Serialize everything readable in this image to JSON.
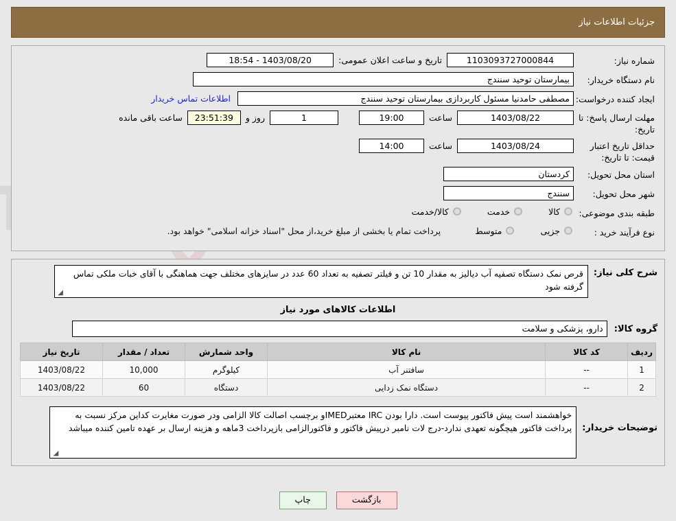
{
  "header": {
    "title": "جزئیات اطلاعات نیاز"
  },
  "fields": {
    "need_number_label": "شماره نیاز:",
    "need_number_value": "1103093727000844",
    "announce_label": "تاریخ و ساعت اعلان عمومی:",
    "announce_value": "1403/08/20 - 18:54",
    "buyer_org_label": "نام دستگاه خریدار:",
    "buyer_org_value": "بیمارستان توحید سنندج",
    "requester_label": "ایجاد کننده درخواست:",
    "requester_value": "مصطفی حامدنیا مسئول کاربردازی بیمارستان توحید سنندج",
    "contact_link": "اطلاعات تماس خریدار",
    "reply_deadline_label": "مهلت ارسال پاسخ: تا تاریخ:",
    "reply_deadline_date": "1403/08/22",
    "hour_label": "ساعت",
    "reply_deadline_time": "19:00",
    "days_value": "1",
    "days_sep_label": "روز و",
    "countdown_value": "23:51:39",
    "countdown_suffix": "ساعت باقی مانده",
    "price_validity_label": "حداقل تاریخ اعتبار قیمت: تا تاریخ:",
    "price_validity_date": "1403/08/24",
    "price_validity_time": "14:00",
    "province_label": "استان محل تحویل:",
    "province_value": "کردستان",
    "city_label": "شهر محل تحویل:",
    "city_value": "سنندج",
    "category_label": "طبقه بندی موضوعی:",
    "category_options": [
      "کالا",
      "خدمت",
      "کالا/خدمت"
    ],
    "process_label": "نوع فرآیند خرید :",
    "process_options": [
      "جزیی",
      "متوسط"
    ],
    "process_note": "پرداخت تمام یا بخشی از مبلغ خرید،از محل \"اسناد خزانه اسلامی\" خواهد بود."
  },
  "description": {
    "label": "شرح کلی نیاز:",
    "value": "قرص نمک دستگاه تصفیه آب دیالیز به مقدار 10 تن و فیلتر تصفیه به تعداد 60 عدد در سایزهای مختلف جهت هماهنگی با آقای خبات ملکی تماس گرفته شود"
  },
  "goods_section": {
    "title": "اطلاعات کالاهای مورد نیاز",
    "group_label": "گروه کالا:",
    "group_value": "دارو، پزشکی و سلامت",
    "columns": [
      "ردیف",
      "کد کالا",
      "نام کالا",
      "واحد شمارش",
      "تعداد / مقدار",
      "تاریخ نیاز"
    ],
    "rows": [
      {
        "row": "1",
        "code": "--",
        "name": "سافتنر آب",
        "unit": "کیلوگرم",
        "qty": "10,000",
        "date": "1403/08/22"
      },
      {
        "row": "2",
        "code": "--",
        "name": "دستگاه نمک زدایی",
        "unit": "دستگاه",
        "qty": "60",
        "date": "1403/08/22"
      }
    ]
  },
  "buyer_notes": {
    "label": "توضیحات خریدار:",
    "value": "خواهشمند است پیش فاکتور پیوست است. دارا بودن IRC معتبرIMEDو برچسب اصالت کالا الزامی ودر صورت مغایرت کداین مرکز نسبت به پرداخت فاکتور هیچگونه تعهدی ندارد-درج لات نامبر درپیش فاکتور و فاکتورالزامی  بازپرداخت 3ماهه و هزینه ارسال بر عهده تامین کننده میباشد"
  },
  "buttons": {
    "print": "چاپ",
    "back": "بازگشت"
  },
  "watermark": {
    "text": "AriaTender.net"
  },
  "colors": {
    "header_bg": "#8d6e43",
    "link": "#2020e0",
    "print_bg": "#e9f7e9",
    "back_bg": "#fbd9d9",
    "timer_bg": "#fbfbe0"
  }
}
